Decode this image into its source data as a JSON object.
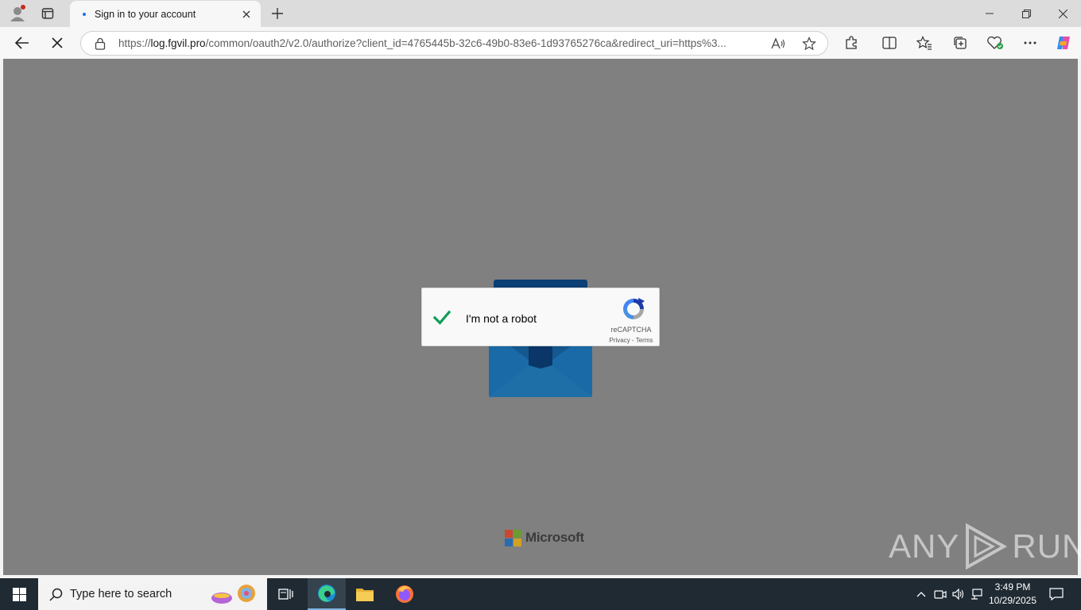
{
  "browser": {
    "tab_title": "Sign in to your account",
    "url_prefix": "https://",
    "url_host": "log.fgvil.pro",
    "url_path": "/common/oauth2/v2.0/authorize?client_id=4765445b-32c6-49b0-83e6-1d93765276ca&redirect_uri=https%3..."
  },
  "captcha": {
    "label": "I'm not a robot",
    "brand": "reCAPTCHA",
    "privacy": "Privacy",
    "separator": " - ",
    "terms": "Terms",
    "checked": true
  },
  "footer": {
    "brand": "Microsoft"
  },
  "watermark": {
    "left": "ANY",
    "right": "RUN"
  },
  "taskbar": {
    "search_placeholder": "Type here to search",
    "time": "3:49 PM",
    "date": "10/29/2025"
  },
  "colors": {
    "overlay": "#808080",
    "mail_dark": "#0b4f8a",
    "mail_light": "#1a6aa8",
    "check": "#0f9d58",
    "taskbar": "#1f2a33"
  }
}
